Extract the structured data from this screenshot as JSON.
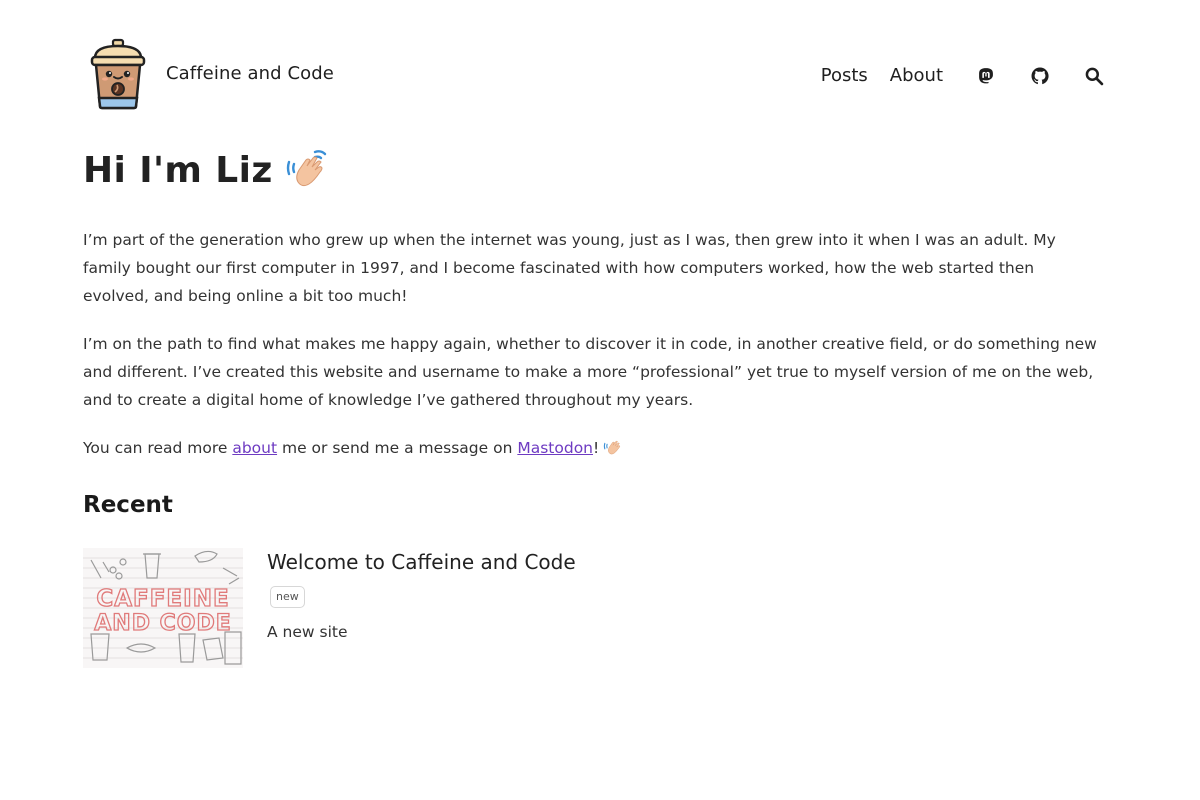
{
  "site": {
    "name": "Caffeine and Code"
  },
  "nav": {
    "items": [
      {
        "label": "Posts"
      },
      {
        "label": "About"
      }
    ],
    "icons": [
      "mastodon-icon",
      "github-icon",
      "search-icon"
    ]
  },
  "intro": {
    "title": "Hi I'm Liz",
    "paragraph1": "I’m part of the generation who grew up when the internet was young, just as I was, then grew into it when I was an adult. My family bought our first computer in 1997, and I become fascinated with how computers worked, how the web started then evolved, and being online a bit too much!",
    "paragraph2": "I’m on the path to find what makes me happy again, whether to discover it in code, in another creative field, or do something new and different. I’ve created this website and username to make a more “professional” yet true to myself version of me on the web, and to create a digital home of knowledge I’ve gathered throughout my years.",
    "p3_prefix": "You can read more ",
    "p3_link_about": "about",
    "p3_middle": " me or send me a message on ",
    "p3_link_mastodon": "Mastodon",
    "p3_suffix": "!"
  },
  "recent": {
    "heading": "Recent",
    "posts": [
      {
        "title": "Welcome to Caffeine and Code",
        "tag": "new",
        "description": "A new site",
        "thumbnail_text_line1": "CAFFEINE",
        "thumbnail_text_line2": "AND CODE"
      }
    ]
  },
  "colors": {
    "link": "#6e3bc2",
    "text": "#333333",
    "thumbnail_text": "#e07a7a"
  }
}
